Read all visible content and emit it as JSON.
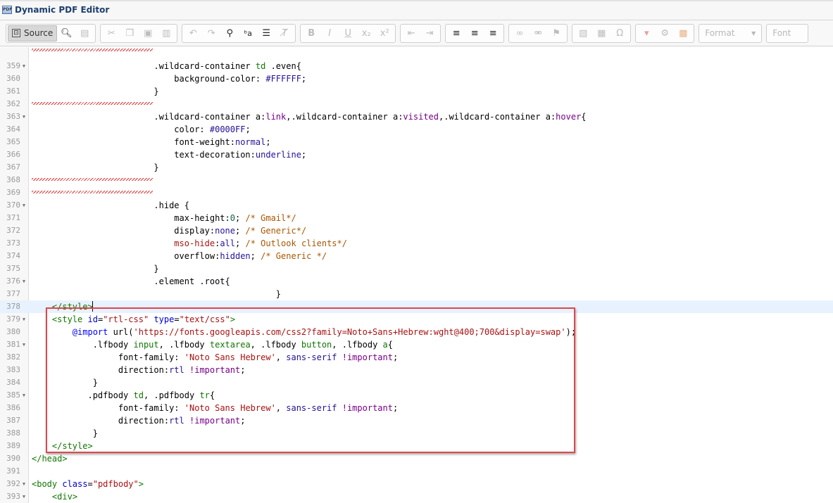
{
  "window": {
    "title": "Dynamic PDF Editor",
    "app_icon": "pdf-icon"
  },
  "toolbar": {
    "source_label": "Source",
    "format_label": "Format",
    "font_label": "Font",
    "icons": [
      "preview-icon",
      "templates-icon",
      "cut-icon",
      "copy-icon",
      "paste-icon",
      "paste-text-icon",
      "undo-icon",
      "redo-icon",
      "find-icon",
      "replace-icon",
      "select-all-icon",
      "remove-format-icon",
      "bold-icon",
      "italic-icon",
      "underline-icon",
      "subscript-icon",
      "superscript-icon",
      "decrease-indent-icon",
      "increase-indent-icon",
      "align-left-icon",
      "align-center-icon",
      "align-right-icon",
      "link-icon",
      "unlink-icon",
      "anchor-icon",
      "image-icon",
      "table-icon",
      "special-char-icon",
      "placeholder-icon",
      "settings-icon",
      "insert-image-icon"
    ]
  },
  "colors": {
    "highlight_border": "#e0474c",
    "tag": "#117700",
    "attribute": "#0000cc",
    "string": "#aa1111",
    "comment": "#aa5500",
    "keyword": "#770088"
  },
  "lines": [
    {
      "n": "",
      "fold": "",
      "squiggle": true,
      "code": ""
    },
    {
      "n": "359",
      "fold": "▼",
      "code": "                        .wildcard-container td .even{"
    },
    {
      "n": "360",
      "fold": "",
      "code": "                            background-color: #FFFFFF;"
    },
    {
      "n": "361",
      "fold": "",
      "code": "                        }"
    },
    {
      "n": "362",
      "fold": "",
      "squiggle": true,
      "code": ""
    },
    {
      "n": "363",
      "fold": "▼",
      "code": "                        .wildcard-container a:link,.wildcard-container a:visited,.wildcard-container a:hover{"
    },
    {
      "n": "364",
      "fold": "",
      "code": "                            color: #0000FF;"
    },
    {
      "n": "365",
      "fold": "",
      "code": "                            font-weight:normal;"
    },
    {
      "n": "366",
      "fold": "",
      "code": "                            text-decoration:underline;"
    },
    {
      "n": "367",
      "fold": "",
      "code": "                        }"
    },
    {
      "n": "368",
      "fold": "",
      "squiggle": true,
      "code": ""
    },
    {
      "n": "369",
      "fold": "",
      "squiggle": true,
      "code": ""
    },
    {
      "n": "370",
      "fold": "▼",
      "code": "                        .hide {"
    },
    {
      "n": "371",
      "fold": "",
      "code": "                            max-height:0; /* Gmail*/"
    },
    {
      "n": "372",
      "fold": "",
      "code": "                            display:none; /* Generic*/"
    },
    {
      "n": "373",
      "fold": "",
      "code": "                            mso-hide:all; /* Outlook clients*/"
    },
    {
      "n": "374",
      "fold": "",
      "code": "                            overflow:hidden; /* Generic */"
    },
    {
      "n": "375",
      "fold": "",
      "code": "                        }"
    },
    {
      "n": "376",
      "fold": "▼",
      "code": "                        .element .root{"
    },
    {
      "n": "377",
      "fold": "",
      "code": "                                                }"
    },
    {
      "n": "378",
      "fold": "",
      "current": true,
      "code": "    </style>"
    },
    {
      "n": "379",
      "fold": "▼",
      "code": "    <style id=\"rtl-css\" type=\"text/css\">"
    },
    {
      "n": "380",
      "fold": "",
      "code": "        @import url('https://fonts.googleapis.com/css2?family=Noto+Sans+Hebrew:wght@400;700&display=swap');"
    },
    {
      "n": "381",
      "fold": "▼",
      "code": "            .lfbody input, .lfbody textarea, .lfbody button, .lfbody a{"
    },
    {
      "n": "382",
      "fold": "",
      "code": "                 font-family: 'Noto Sans Hebrew', sans-serif !important;"
    },
    {
      "n": "383",
      "fold": "",
      "code": "                 direction:rtl !important;"
    },
    {
      "n": "384",
      "fold": "",
      "code": "            }"
    },
    {
      "n": "385",
      "fold": "▼",
      "code": "           .pdfbody td, .pdfbody tr{"
    },
    {
      "n": "386",
      "fold": "",
      "code": "                 font-family: 'Noto Sans Hebrew', sans-serif !important;"
    },
    {
      "n": "387",
      "fold": "",
      "code": "                 direction:rtl !important;"
    },
    {
      "n": "388",
      "fold": "",
      "code": "            }"
    },
    {
      "n": "389",
      "fold": "",
      "code": "    </style>"
    },
    {
      "n": "390",
      "fold": "",
      "code": "</head>"
    },
    {
      "n": "391",
      "fold": "",
      "code": ""
    },
    {
      "n": "392",
      "fold": "▼",
      "code": "<body class=\"pdfbody\">"
    },
    {
      "n": "393",
      "fold": "▼",
      "code": "    <div>"
    }
  ]
}
